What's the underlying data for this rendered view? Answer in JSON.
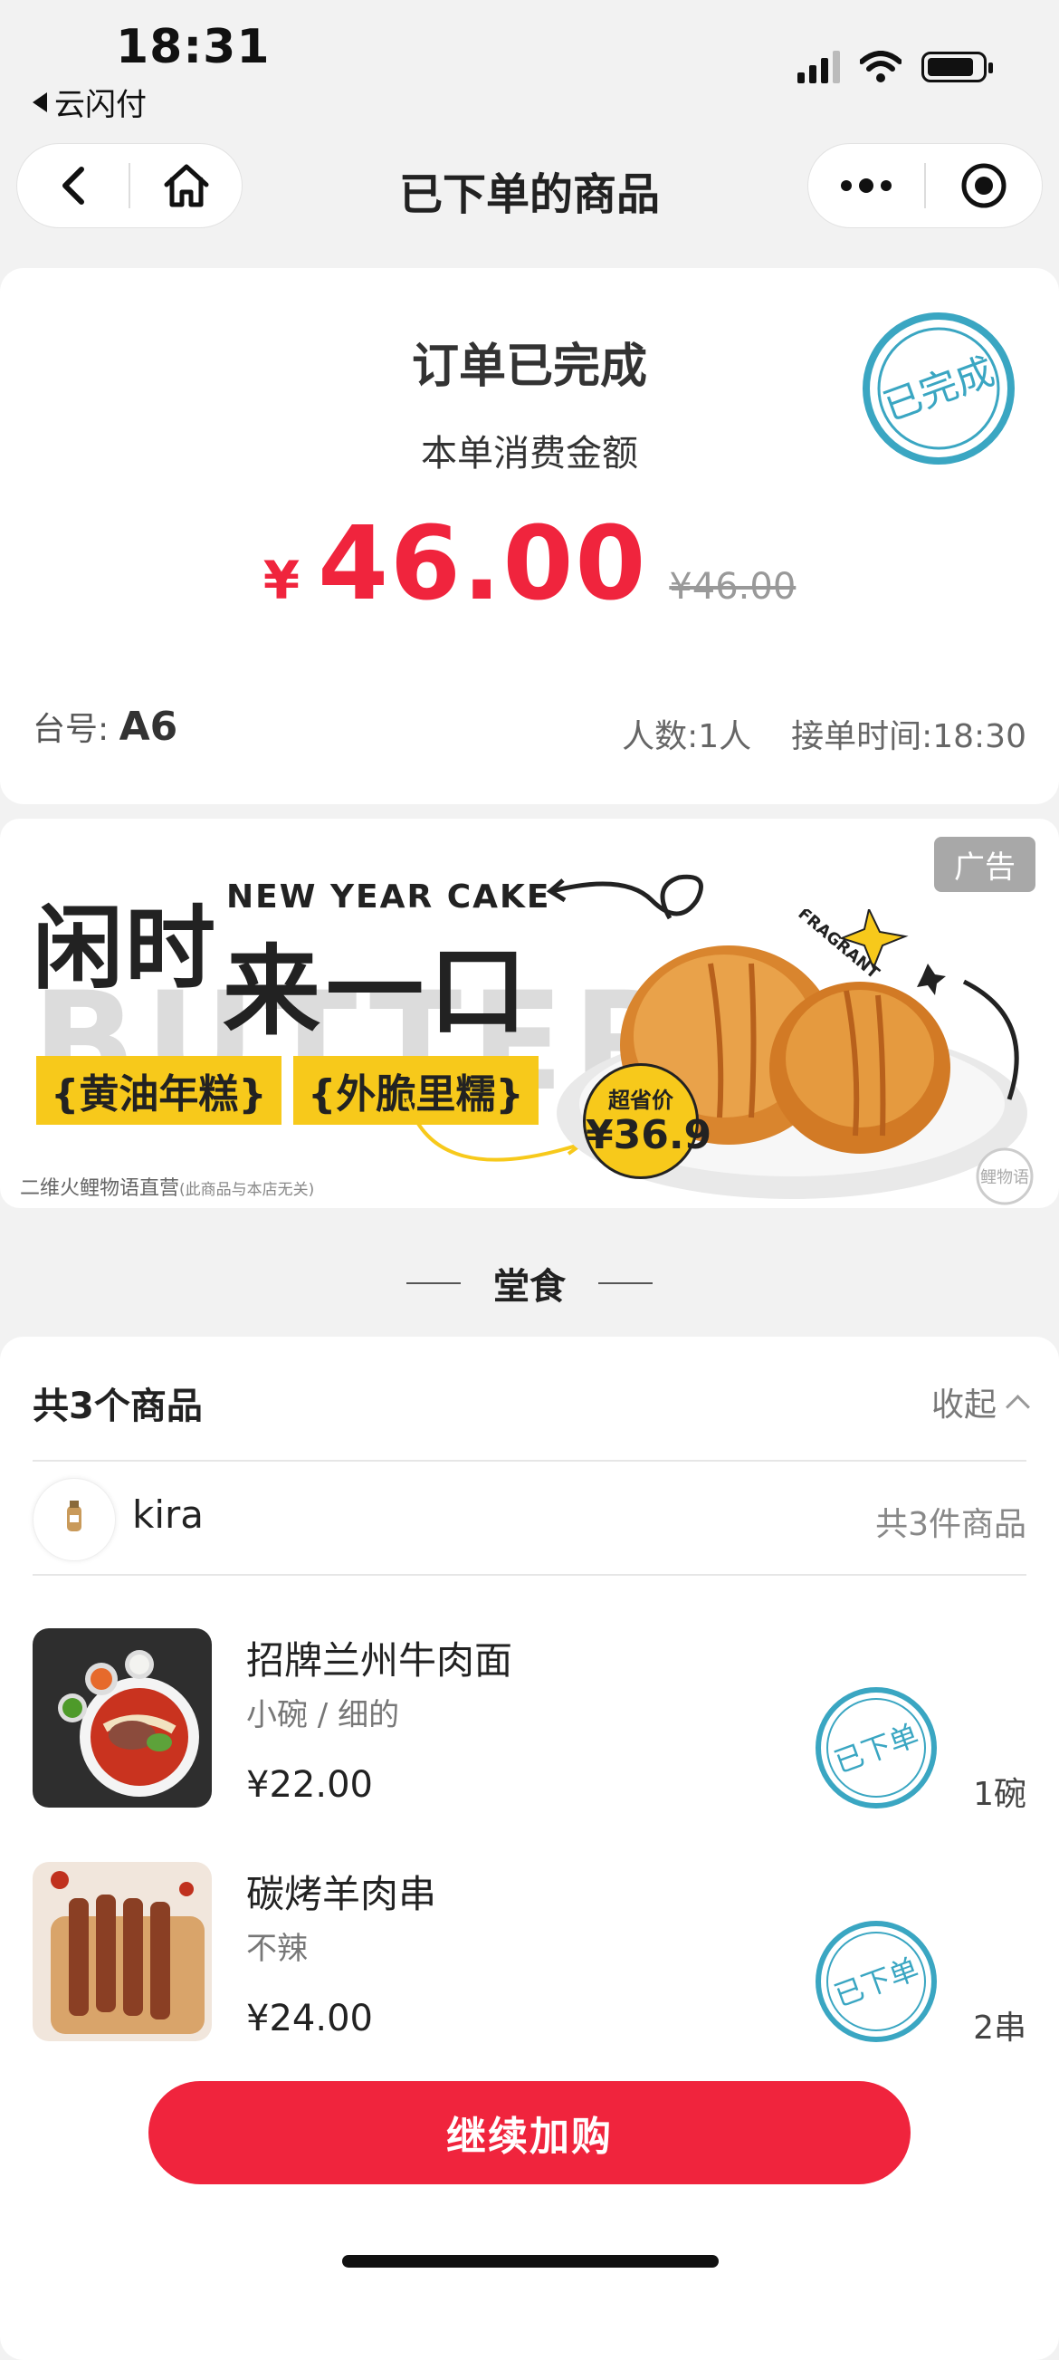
{
  "status_bar": {
    "time": "18:31",
    "back_app": "云闪付"
  },
  "nav": {
    "title": "已下单的商品"
  },
  "order": {
    "status": "订单已完成",
    "amount_label": "本单消费金额",
    "currency": "¥",
    "amount": "46.00",
    "original_amount": "¥46.00",
    "stamp": "已完成",
    "table_label": "台号:",
    "table_value": "A6",
    "people": "人数:1人",
    "order_time": "接单时间:18:30"
  },
  "ad": {
    "tag": "广告",
    "headline1": "闲时",
    "headline_en": "NEW YEAR CAKE",
    "headline2": "来一口",
    "background_word": "BUTTER",
    "chip1": "{黄油年糕}",
    "chip2": "{外脆里糯}",
    "badge_label": "超省价",
    "badge_price": "¥36.9",
    "footer": "二维火鲤物语直营",
    "footer_note": "(此商品与本店无关)",
    "fragrant": "FRAGRANT",
    "brand": "鲤物语"
  },
  "section": {
    "title": "堂食"
  },
  "items_card": {
    "title": "共3个商品",
    "collapse_label": "收起",
    "user_name": "kira",
    "user_count": "共3件商品",
    "items": [
      {
        "name": "招牌兰州牛肉面",
        "spec": "小碗 / 细的",
        "price": "¥22.00",
        "qty": "1碗",
        "stamp": "已下单"
      },
      {
        "name": "碳烤羊肉串",
        "spec": "不辣",
        "price": "¥24.00",
        "qty": "2串",
        "stamp": "已下单"
      }
    ]
  },
  "cta": {
    "label": "继续加购"
  },
  "colors": {
    "accent": "#f0243d",
    "stamp": "#3aa6c2",
    "ad_yellow": "#f7c91b"
  }
}
